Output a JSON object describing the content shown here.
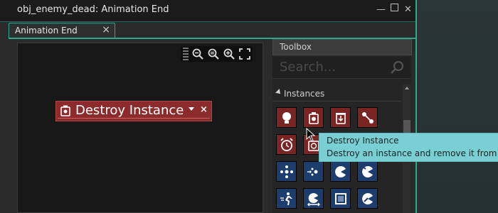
{
  "window": {
    "title": "obj_enemy_dead: Animation End",
    "minimize_icon": "minimize-icon",
    "maximize_icon": "maximize-icon",
    "close_icon": "close-icon"
  },
  "tab": {
    "label": "Animation End",
    "close": "×"
  },
  "zoom_toolbar": {
    "icons": [
      "zoom-out-icon",
      "zoom-reset-icon",
      "zoom-in-icon",
      "fit-screen-icon"
    ]
  },
  "action_block": {
    "label": "Destroy Instance",
    "icon": "destroy-instance-icon",
    "dropdown": "▾",
    "close": "×",
    "color": "#8c2b2b"
  },
  "toolbox": {
    "title": "Toolbox",
    "search_placeholder": "Search...",
    "section_label": "Instances",
    "tiles": [
      {
        "icon": "create-instance-icon",
        "color": "red"
      },
      {
        "icon": "destroy-instance-icon",
        "color": "red"
      },
      {
        "icon": "destroy-at-location-icon",
        "color": "red"
      },
      {
        "icon": "change-instance-icon",
        "color": "red"
      },
      {
        "icon": "alarm-icon",
        "color": "red"
      },
      {
        "icon": "timer-icon",
        "color": "red"
      },
      {
        "icon": "move-fixed-icon",
        "color": "blue"
      },
      {
        "icon": "move-free-icon",
        "color": "blue"
      },
      {
        "icon": "set-speed-icon",
        "color": "blue"
      },
      {
        "icon": "jump-icon",
        "color": "blue"
      },
      {
        "icon": "move-towards-icon",
        "color": "blue"
      },
      {
        "icon": "bounce-icon",
        "color": "blue"
      },
      {
        "icon": "wrap-icon",
        "color": "blue"
      },
      {
        "icon": "path-icon",
        "color": "blue"
      }
    ]
  },
  "tooltip": {
    "title": "Destroy Instance",
    "description": "Destroy an instance and remove it from the"
  }
}
